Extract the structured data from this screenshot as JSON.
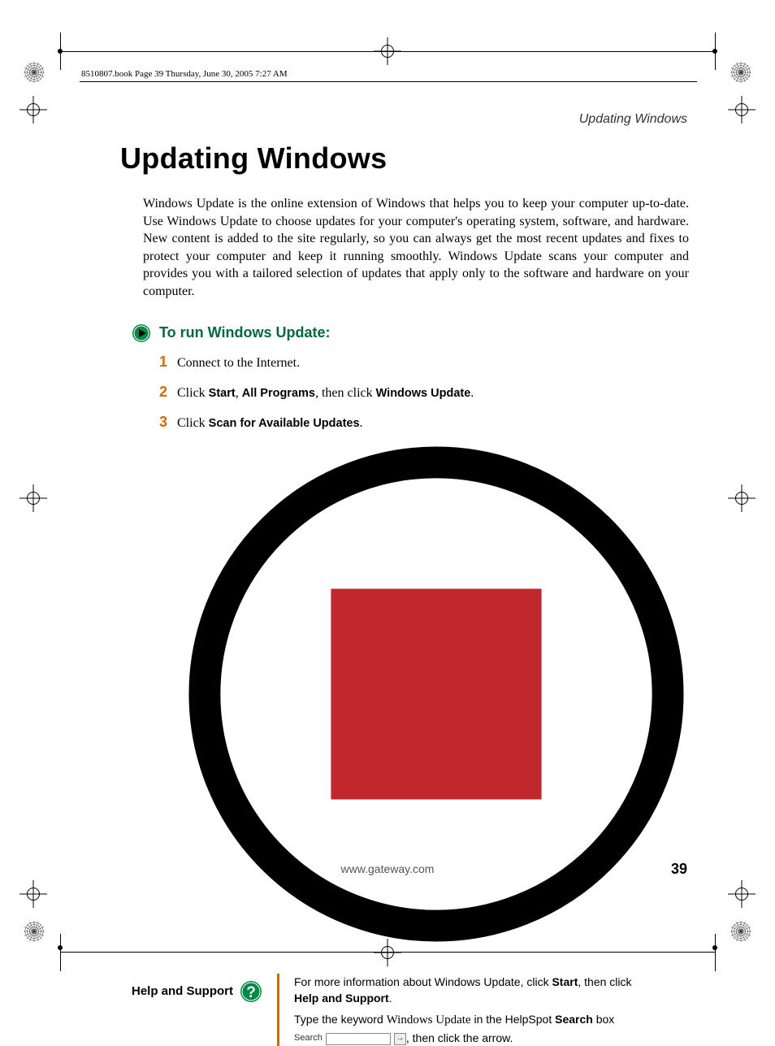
{
  "book_header": "8510807.book  Page 39  Thursday, June 30, 2005  7:27 AM",
  "running_head": "Updating Windows",
  "title": "Updating Windows",
  "intro": "Windows Update is the online extension of Windows that helps you to keep your computer up-to-date. Use Windows Update to choose updates for your computer's operating system, software, and hardware. New content is added to the site regularly, so you can always get the most recent updates and fixes to protect your computer and keep it running smoothly. Windows Update scans your computer and provides you with a tailored selection of updates that apply only to the software and hardware on your computer.",
  "procedure_heading": "To run Windows Update:",
  "steps": {
    "n1": "1",
    "t1": "Connect to the Internet.",
    "n2": "2",
    "t2_a": "Click ",
    "t2_b1": "Start",
    "t2_c": ", ",
    "t2_b2": "All Programs",
    "t2_d": ", then click ",
    "t2_b3": "Windows Update",
    "t2_e": ".",
    "n3": "3",
    "t3_a": "Click ",
    "t3_b": "Scan for Available Updates",
    "t3_c": "."
  },
  "help": {
    "label": "Help and Support",
    "line1_a": "For more information about Windows Update, click ",
    "line1_b": "Start",
    "line1_c": ", then click ",
    "line1_d": "Help and Support",
    "line1_e": ".",
    "line2_a": "Type the keyword ",
    "line2_kw": "Windows Update",
    "line2_b": " in the HelpSpot ",
    "line2_c": "Search",
    "line2_d": " box ",
    "search_label": "Search",
    "search_arrow": "→",
    "line2_e": ", then click the arrow."
  },
  "footer": {
    "url": "www.gateway.com",
    "page": "39"
  }
}
